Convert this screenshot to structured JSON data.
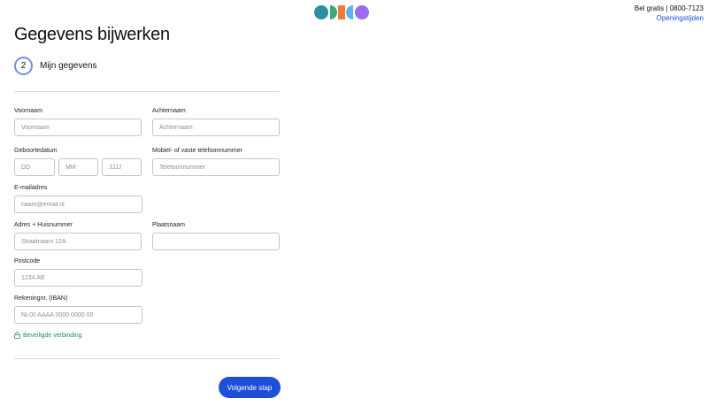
{
  "brand": {
    "logo_colors": [
      "#2b8fa0",
      "#3da878",
      "#f07a3a",
      "#5fb0e8",
      "#9a6cf0"
    ]
  },
  "header": {
    "phone_text": "Bel gratis | 0800-7123",
    "hours_link": "Openingstijden"
  },
  "page": {
    "title": "Gegevens bijwerken"
  },
  "step": {
    "number": "2",
    "label": "Mijn gegevens"
  },
  "form": {
    "first_name": {
      "label": "Voornaam",
      "placeholder": "Voornaam",
      "value": ""
    },
    "last_name": {
      "label": "Achternaam",
      "placeholder": "Achternaam",
      "value": ""
    },
    "birth_date": {
      "label": "Geboortedatum",
      "day_placeholder": "DD",
      "month_placeholder": "MM",
      "year_placeholder": "JJJJ"
    },
    "phone": {
      "label": "Mobiel- of vaste telefoonnummer",
      "placeholder": "Telefoonnummer",
      "value": ""
    },
    "email": {
      "label": "E-mailadres",
      "placeholder": "naam@email.nl",
      "value": ""
    },
    "address": {
      "label": "Adres + Huisnummer",
      "placeholder": "Straatnaam 12A",
      "value": ""
    },
    "city": {
      "label": "Plaatsnaam",
      "placeholder": "",
      "value": ""
    },
    "postcode": {
      "label": "Postcode",
      "placeholder": "1234 AB",
      "value": ""
    },
    "iban": {
      "label": "Rekeningnr. (IBAN)",
      "placeholder": "NL00 AAAA 0000 0000 00",
      "value": ""
    }
  },
  "security": {
    "text": "Beveiligde verbinding"
  },
  "actions": {
    "next_label": "Volgende stap"
  },
  "colors": {
    "primary": "#1d4fd8",
    "secure": "#1a8a7a"
  }
}
